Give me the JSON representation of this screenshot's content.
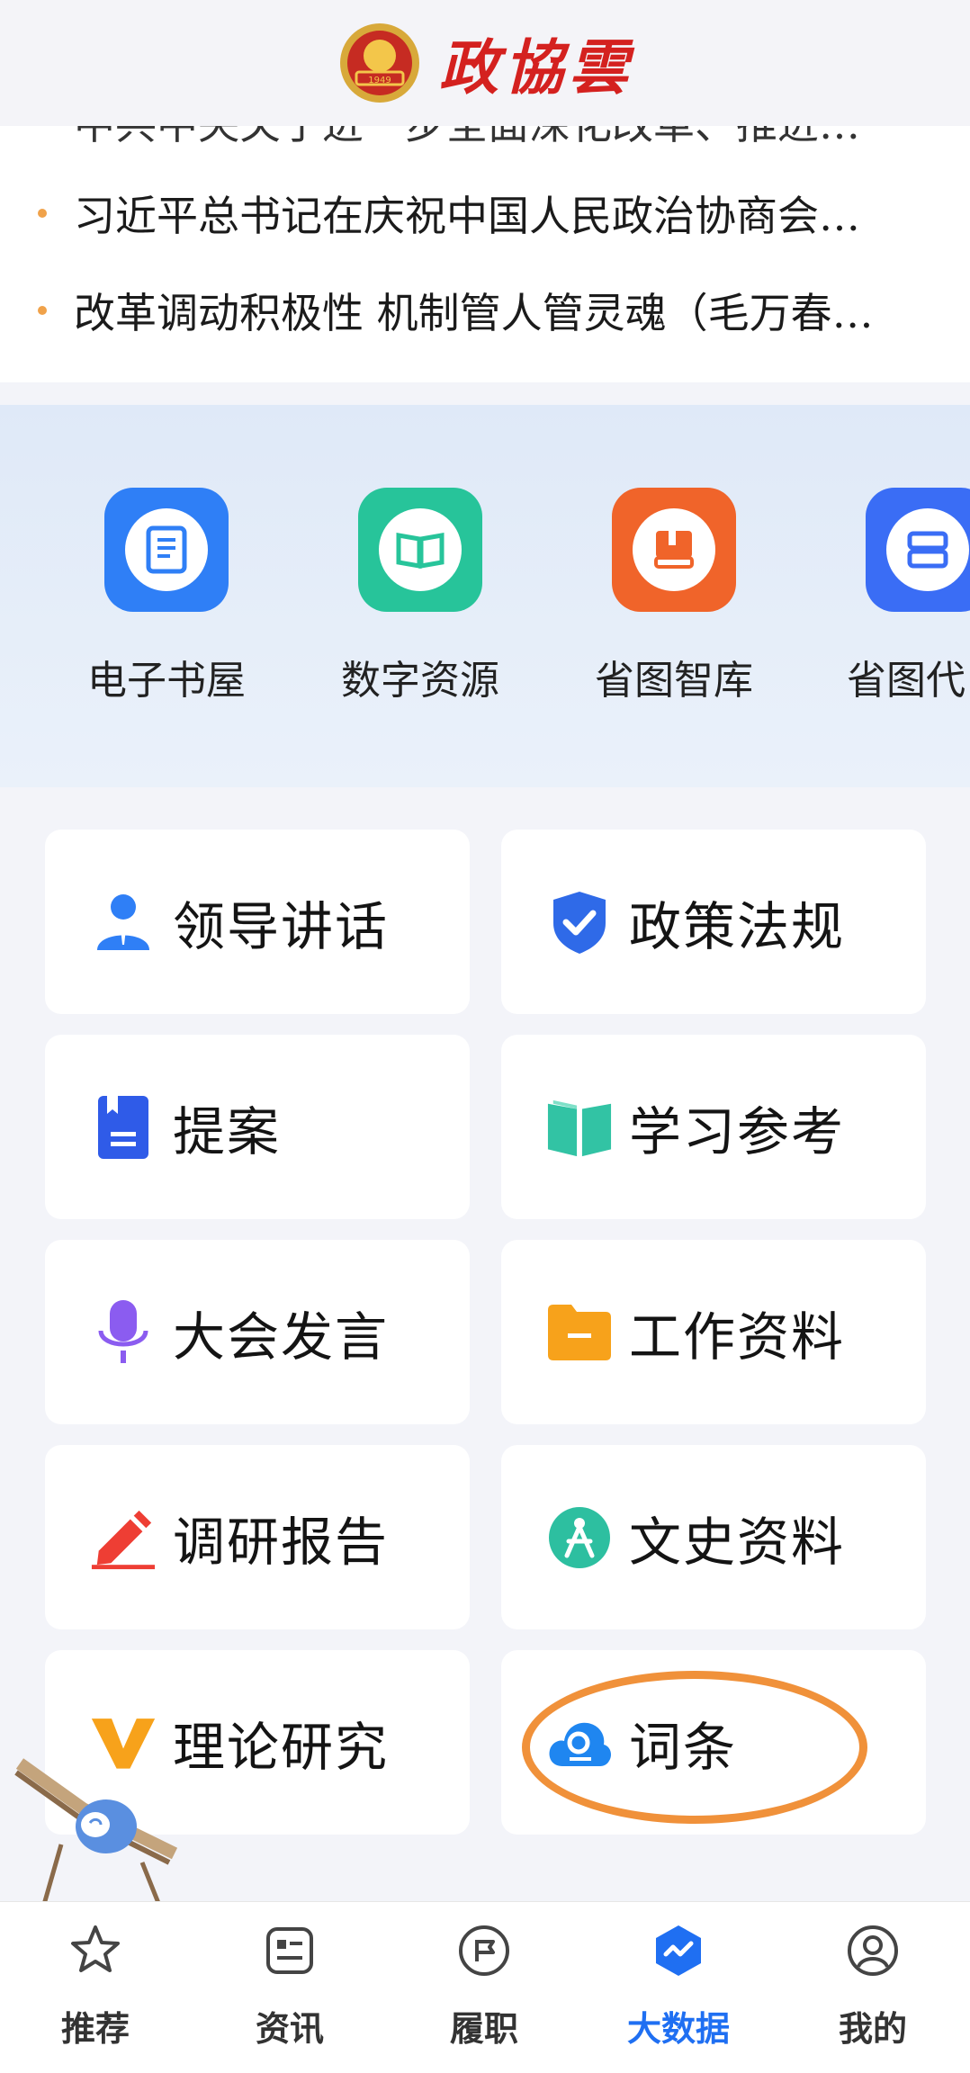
{
  "header": {
    "brand": "政協雲",
    "emblem_year": "1949"
  },
  "news": {
    "cut_line": "中共中央关于进一步全面深化改革、推进…",
    "items": [
      "习近平总书记在庆祝中国人民政治协商会…",
      "改革调动积极性 机制管人管灵魂（毛万春…"
    ]
  },
  "shortcuts": [
    {
      "label": "电子书屋",
      "icon": "ebook-icon",
      "color": "#2f7ff6"
    },
    {
      "label": "数字资源",
      "icon": "open-book-icon",
      "color": "#27c49a"
    },
    {
      "label": "省图智库",
      "icon": "book-stack-icon",
      "color": "#f0642a"
    },
    {
      "label": "省图代",
      "icon": "library-icon",
      "color": "#3a6df5"
    }
  ],
  "grid": [
    {
      "label": "领导讲话",
      "icon": "speaker-person-icon"
    },
    {
      "label": "政策法规",
      "icon": "shield-check-icon"
    },
    {
      "label": "提案",
      "icon": "bookmark-doc-icon"
    },
    {
      "label": "学习参考",
      "icon": "open-book-icon"
    },
    {
      "label": "大会发言",
      "icon": "microphone-icon"
    },
    {
      "label": "工作资料",
      "icon": "folder-icon"
    },
    {
      "label": "调研报告",
      "icon": "pencil-icon"
    },
    {
      "label": "文史资料",
      "icon": "compass-icon"
    },
    {
      "label": "理论研究",
      "icon": "v-letter-icon"
    },
    {
      "label": "词条",
      "icon": "cloud-search-icon"
    }
  ],
  "tabbar": [
    {
      "label": "推荐",
      "icon": "star-icon",
      "active": false
    },
    {
      "label": "资讯",
      "icon": "news-icon",
      "active": false
    },
    {
      "label": "履职",
      "icon": "flag-badge-icon",
      "active": false
    },
    {
      "label": "大数据",
      "icon": "data-pulse-icon",
      "active": true
    },
    {
      "label": "我的",
      "icon": "user-icon",
      "active": false
    }
  ],
  "colors": {
    "accent": "#1f6ff2",
    "highlight": "#f0913a",
    "brand_red": "#d4211f"
  }
}
